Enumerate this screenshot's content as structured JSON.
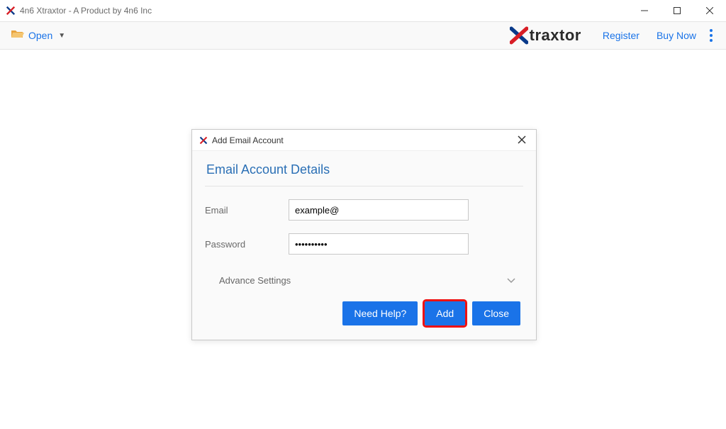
{
  "window": {
    "title": "4n6 Xtraxtor - A Product by 4n6 Inc"
  },
  "toolbar": {
    "open_label": "Open",
    "brand_text": "traxtor",
    "register_label": "Register",
    "buynow_label": "Buy Now"
  },
  "dialog": {
    "title": "Add Email Account",
    "heading": "Email Account Details",
    "email_label": "Email",
    "email_value": "example@",
    "password_label": "Password",
    "password_value": "••••••••••",
    "advance_label": "Advance Settings",
    "need_help_label": "Need Help?",
    "add_label": "Add",
    "close_label": "Close"
  }
}
